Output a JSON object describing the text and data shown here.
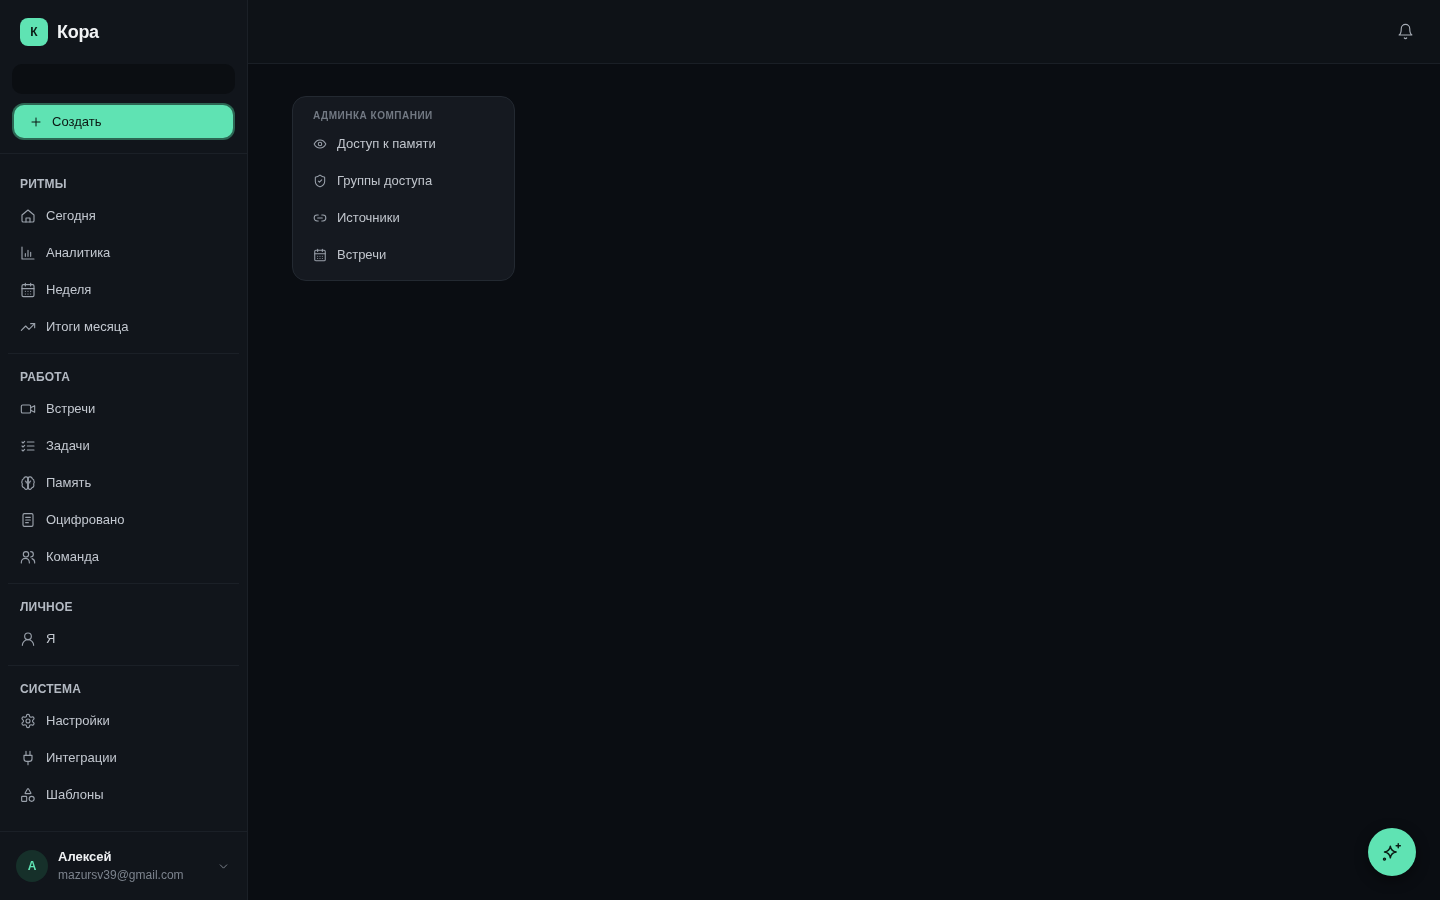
{
  "sidebar": {
    "brand": {
      "logo_letter": "К",
      "name": "Кора"
    },
    "create_button": {
      "label": "Создать"
    },
    "sections": [
      {
        "title": "РИТМЫ",
        "items": [
          {
            "label": "Сегодня",
            "selected": false
          },
          {
            "label": "Аналитика",
            "selected": false
          },
          {
            "label": "Неделя",
            "selected": false
          },
          {
            "label": "Итоги месяца",
            "selected": false
          }
        ]
      },
      {
        "title": "РАБОТА",
        "items": [
          {
            "label": "Встречи",
            "selected": false
          },
          {
            "label": "Задачи",
            "selected": false
          },
          {
            "label": "Память",
            "selected": false
          },
          {
            "label": "Оцифровано",
            "selected": false
          },
          {
            "label": "Команда",
            "selected": false
          }
        ]
      },
      {
        "title": "ЛИЧНОЕ",
        "items": [
          {
            "label": "Я",
            "selected": false
          }
        ]
      },
      {
        "title": "СИСТЕМА",
        "items": [
          {
            "label": "Настройки",
            "selected": false
          },
          {
            "label": "Интеграции",
            "selected": false
          },
          {
            "label": "Шаблоны",
            "selected": false
          }
        ]
      }
    ],
    "user": {
      "initial": "А",
      "name": "Алексей",
      "email": "mazursv39@gmail.com"
    }
  },
  "admin_menu": {
    "title": "АДМИНКА КОМПАНИИ",
    "items": [
      {
        "label": "Доступ к памяти"
      },
      {
        "label": "Группы доступа"
      },
      {
        "label": "Источники"
      },
      {
        "label": "Встречи"
      }
    ]
  }
}
